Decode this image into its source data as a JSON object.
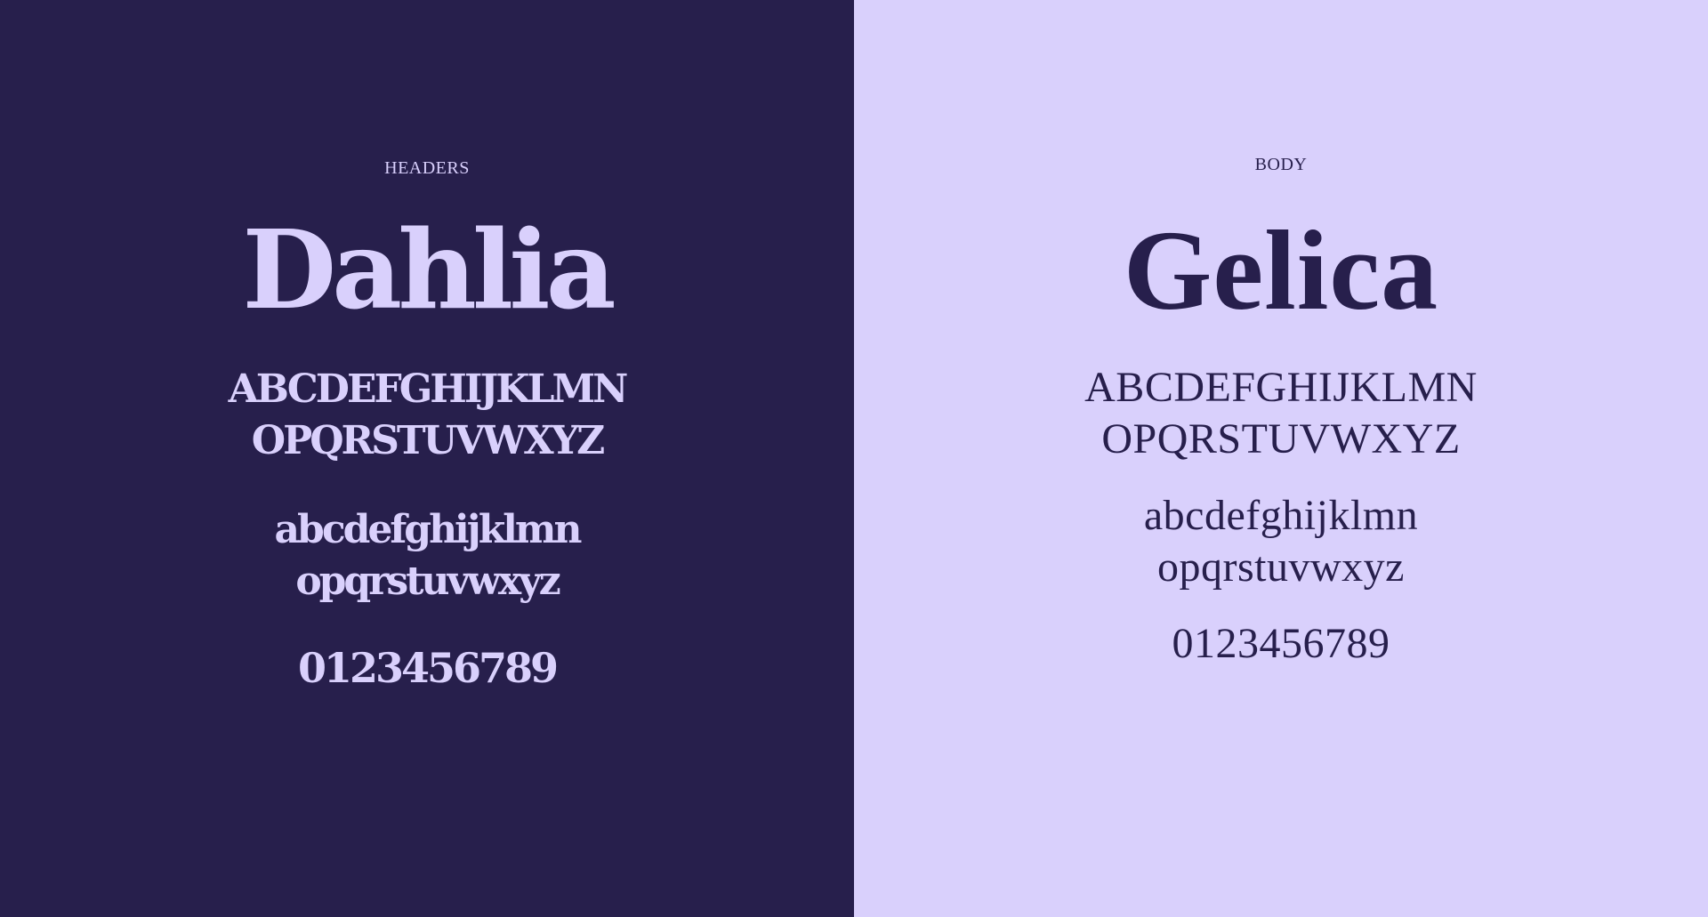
{
  "colors": {
    "dark": "#271f4c",
    "light": "#d9d0fc"
  },
  "headers_panel": {
    "label": "HEADERS",
    "font_name": "Dahlia",
    "uppercase_line1": "ABCDEFGHIJKLMN",
    "uppercase_line2": "OPQRSTUVWXYZ",
    "lowercase_line1": "abcdefghijklmn",
    "lowercase_line2": "opqrstuvwxyz",
    "digits": "0123456789"
  },
  "body_panel": {
    "label": "BODY",
    "font_name": "Gelica",
    "uppercase_line1": "ABCDEFGHIJKLMN",
    "uppercase_line2": "OPQRSTUVWXYZ",
    "lowercase_line1": "abcdefghijklmn",
    "lowercase_line2": "opqrstuvwxyz",
    "digits": "0123456789"
  }
}
